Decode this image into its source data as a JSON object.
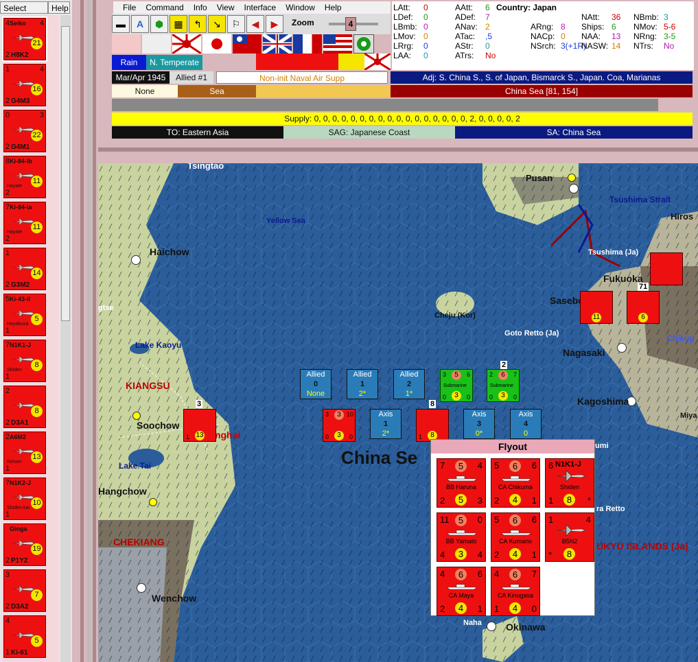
{
  "left_panel": {
    "select_label": "Select",
    "help_label": "Help",
    "units": [
      {
        "name": "H8K2",
        "title": "Seiko",
        "tl": "4",
        "tr": "4",
        "bl": "2",
        "coin": "21",
        "selected": true
      },
      {
        "name": "G4M3",
        "tl": "1",
        "tr": "4",
        "bl": "2",
        "coin": "16"
      },
      {
        "name": "G4M1",
        "tl": "0",
        "tr": "3",
        "bl": "2",
        "coin": "22"
      },
      {
        "name": "",
        "title": "Ki-84-Ib",
        "sub": "Hayate",
        "tl": "8",
        "bl": "2",
        "coin": "11"
      },
      {
        "name": "",
        "title": "Ki-84-Ia",
        "sub": "Hayate",
        "tl": "7",
        "bl": "2",
        "coin": "11"
      },
      {
        "name": "G3M2",
        "tl": "1",
        "tr": "",
        "bl": "2",
        "coin": "14"
      },
      {
        "name": "",
        "title": "Ki-43-II",
        "sub": "Hayabusa",
        "tl": "5",
        "bl": "1",
        "coin": "5"
      },
      {
        "name": "",
        "title": "N1K1-J",
        "sub": "Shiden",
        "tl": "7",
        "bl": "1",
        "coin": "8"
      },
      {
        "name": "D3A1",
        "tl": "2",
        "tr": "",
        "bl": "2",
        "coin": "8"
      },
      {
        "name": "",
        "title": "A6M2",
        "sub": "Reisen",
        "tl": "2",
        "bl": "1",
        "coin": "13"
      },
      {
        "name": "",
        "title": "N1K2-J",
        "sub": "Shiden-kai",
        "tl": "7",
        "bl": "1",
        "coin": "10"
      },
      {
        "name": "P1Y2",
        "title": "Ginga",
        "tl": "",
        "bl": "2",
        "coin": "19"
      },
      {
        "name": "D3A2",
        "tl": "3",
        "tr": "",
        "bl": "2",
        "coin": "7"
      },
      {
        "name": "Ki-61",
        "tl": "4",
        "tr": "",
        "bl": "1",
        "coin": "5"
      }
    ]
  },
  "menu": [
    "File",
    "Command",
    "Info",
    "View",
    "Interface",
    "Window",
    "Help"
  ],
  "zoom": {
    "label": "Zoom",
    "value": "4"
  },
  "weather": {
    "rain": "Rain",
    "zone": "N. Temperate"
  },
  "stats": {
    "country": "Country: Japan",
    "items": [
      {
        "k": "LAtt:",
        "v": "0"
      },
      {
        "k": "LDef:",
        "v": "0"
      },
      {
        "k": "LBmb:",
        "v": "0"
      },
      {
        "k": "LMov:",
        "v": "0"
      },
      {
        "k": "LRrg:",
        "v": "0"
      },
      {
        "k": "LAA:",
        "v": "0"
      },
      {
        "k": "AAtt:",
        "v": "6"
      },
      {
        "k": "ADef:",
        "v": "7"
      },
      {
        "k": "ANav:",
        "v": "2"
      },
      {
        "k": "ATac:",
        "v": ",5"
      },
      {
        "k": "AStr:",
        "v": "0"
      },
      {
        "k": "ATrs:",
        "v": "No"
      },
      {
        "k": "ARng:",
        "v": "8"
      },
      {
        "k": "NACp:",
        "v": "0"
      },
      {
        "k": "NSrch:",
        "v": "3(+1R)"
      },
      {
        "k": "NAtt:",
        "v": "36"
      },
      {
        "k": "Ships:",
        "v": "6"
      },
      {
        "k": "NAA:",
        "v": "13"
      },
      {
        "k": "NASW:",
        "v": "14"
      },
      {
        "k": "NBmb:",
        "v": "3"
      },
      {
        "k": "NMov:",
        "v": "5-6"
      },
      {
        "k": "NRng:",
        "v": "3-5"
      },
      {
        "k": "NTrs:",
        "v": "No"
      }
    ]
  },
  "info_bars": {
    "date": "Mar/Apr 1945",
    "impulse": "Allied #1",
    "phase": "Non-init Naval Air Supp",
    "adjacent": "Adj: S. China S., S. of Japan, Bismarck S., Japan. Coa, Marianas",
    "terrain1": "None",
    "terrain2": "Sea",
    "area": "China Sea [81, 154]",
    "supply": "Supply: 0, 0, 0, 0, 0, 0, 0, 0, 0, 0, 0, 0, 0, 0, 0, 0, 0, 2, 0, 0, 0, 0, 2",
    "to": "TO: Eastern Asia",
    "sag": "SAG: Japanese Coast",
    "sa": "SA: China Sea"
  },
  "map": {
    "labels": {
      "tsingtao": "Tsingtao",
      "yellow_sea": "Yellow Sea",
      "haichow": "Haichow",
      "pusan": "Pusan",
      "tsushima_strait": "Tsushima Strait",
      "hiroshima": "Hiros",
      "tsushima": "Tsushima (Ja)",
      "fukuoka": "Fukuoka",
      "sasebo": "Sasebo",
      "cheju": "Cheju (Kor)",
      "goto": "Goto Retto (Ja)",
      "chikugo": "Chikug",
      "nagasaki": "Nagasaki",
      "kagoshima": "Kagoshima",
      "miya": "Miya",
      "lake_kaoyu": "Lake Kaoyu",
      "kiangsu": "KIANGSU",
      "soochow": "Soochow",
      "shanghai": "nghai",
      "lake_tai": "Lake Tai",
      "hangchow": "Hangchow",
      "chekiang": "CHEKIANG",
      "wenchow": "Wenchow",
      "china_sea": "China Se",
      "naha": "Naha",
      "okinawa": "Okinawa",
      "ryukyu": "UKYU ISLANDS (Ja)",
      "tse": "gtse",
      "rare_retto": "ra Retto",
      "umi": "umi"
    },
    "allied_boxes": [
      {
        "label": "Allied",
        "num": "0",
        "sub": "None"
      },
      {
        "label": "Allied",
        "num": "1",
        "sub": "2*"
      },
      {
        "label": "Allied",
        "num": "2",
        "sub": "1*"
      }
    ],
    "axis_boxes": [
      {
        "label": "Axis",
        "num": "1",
        "sub": "2*"
      },
      {
        "label": "Axis",
        "num": "3",
        "sub": "0*"
      },
      {
        "label": "Axis",
        "num": "4",
        "sub": "0"
      }
    ],
    "submarine_label": "Submarine",
    "stack_counts": [
      "8",
      "2",
      "3",
      "71"
    ]
  },
  "flyout": {
    "title": "Flyout",
    "cards": [
      {
        "name": "BB Haruna",
        "tl": "7",
        "mid": "5",
        "tr": "4",
        "bl": "2",
        "bm": "5",
        "br": "3"
      },
      {
        "name": "CA Chikuma",
        "tl": "5",
        "mid": "6",
        "tr": "6",
        "bl": "2",
        "bm": "4",
        "br": "1"
      },
      {
        "name": "Shiden",
        "title": "N1K1-J",
        "tl": "6",
        "bl": "1",
        "bm": "8",
        "br": "*"
      },
      {
        "name": "BB Yamato",
        "tl": "11",
        "mid": "5",
        "tr": "0",
        "bl": "4",
        "bm": "3",
        "br": "4"
      },
      {
        "name": "CA Kumano",
        "tl": "5",
        "mid": "6",
        "tr": "6",
        "bl": "2",
        "bm": "4",
        "br": "1"
      },
      {
        "name": "B5N2",
        "tl": "1",
        "tr": "4",
        "bl": "*",
        "bm": "8",
        "br": ""
      },
      {
        "name": "CA Maya",
        "tl": "4",
        "mid": "6",
        "tr": "6",
        "bl": "2",
        "bm": "4",
        "br": "1"
      },
      {
        "name": "CA Kinugasa",
        "tl": "4",
        "mid": "6",
        "tr": "7",
        "bl": "1",
        "bm": "4",
        "br": "0"
      }
    ]
  },
  "colors": {
    "unit_red": "#ee1010",
    "allied_blue": "#2a7cb8",
    "sea": "#2a5d9a",
    "sub_green": "#18c018"
  }
}
